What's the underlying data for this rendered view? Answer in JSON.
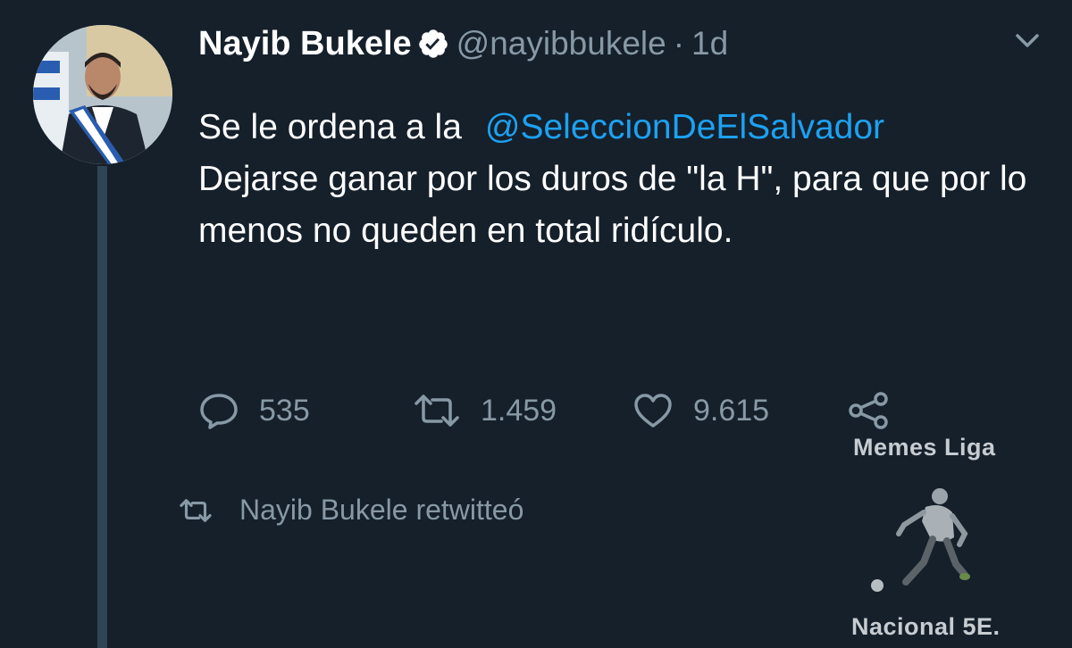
{
  "tweet": {
    "author": {
      "name": "Nayib Bukele",
      "handle": "@nayibbukele",
      "time_separator": "·",
      "time": "1d",
      "verified_icon": "verified-badge-icon",
      "avatar": "profile-photo-avatar"
    },
    "text": {
      "line1_prefix": "Se le ordena a la",
      "mention": "@SeleccionDeElSalvador",
      "body": "Dejarse ganar por los duros de \"la H\", para que por lo menos no queden en total ridículo."
    },
    "actions": {
      "reply_count": "535",
      "retweet_count": "1.459",
      "like_count": "9.615",
      "icons": [
        "reply-icon",
        "retweet-icon",
        "like-icon",
        "share-icon"
      ]
    },
    "menu_icon": "chevron-down-icon"
  },
  "retweet_notice": {
    "icon": "retweet-icon",
    "label": "Nayib Bukele retwitteó"
  },
  "watermark": {
    "top": "Memes Liga",
    "bottom": "Nacional 5E.",
    "figure": "soccer-player-figure"
  },
  "colors": {
    "background": "#15202b",
    "text_primary": "#ffffff",
    "text_secondary": "#8899a6",
    "link": "#1da1f2",
    "thread_line": "#2f4455"
  }
}
